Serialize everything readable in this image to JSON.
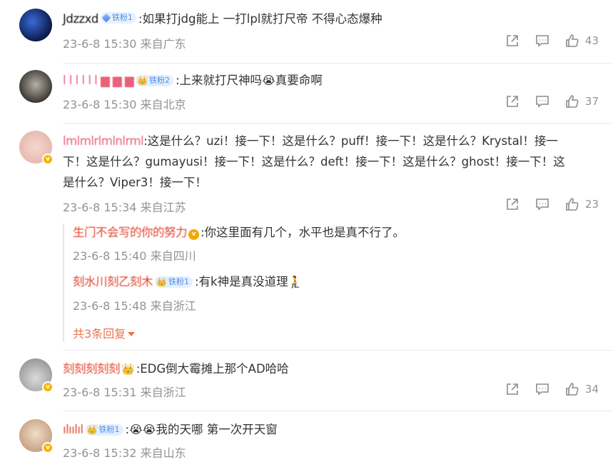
{
  "comments": [
    {
      "username": "Jdzzxd",
      "fan_badge": "铁粉1",
      "text": ":如果打jdg能上 一打lpl就打尺帝 不得心态爆种",
      "time": "23-6-8 15:30",
      "location": "来自广东",
      "likes": "43"
    },
    {
      "username": "l l l l l l    ▆ ▆ ▆",
      "fan_badge": "铁粉2",
      "text": ":上来就打尺神吗",
      "emoji": "😭",
      "text_after": "真要命啊",
      "time": "23-6-8 15:30",
      "location": "来自北京",
      "likes": "37"
    },
    {
      "username": "lmlmlrlmlnlrml",
      "text_line1": ":这是什么？uzi！接一下！这是什么？puff！接一下！这是什么？Krystal！接一",
      "text_line2": "下！这是什么？gumayusi！接一下！这是什么？deft！接一下！这是什么？ghost！接一下！这",
      "text_line3": "是什么？Viper3！接一下！",
      "time": "23-6-8 15:34",
      "location": "来自江苏",
      "likes": "23",
      "replies": [
        {
          "username": "生门不会写的你的努力",
          "text": ":你这里面有几个，水平也是真不行了。",
          "time": "23-6-8 15:40",
          "location": "来自四川"
        },
        {
          "username": "刻水川刻乙刻木",
          "fan_badge": "铁粉1",
          "text": ":有k神是真没道理",
          "emoji": "🧎",
          "time": "23-6-8 15:48",
          "location": "来自浙江"
        }
      ],
      "more_replies": "共3条回复"
    },
    {
      "username": "刻刻刻刻刻",
      "text": ":EDG倒大霉摊上那个AD哈哈",
      "time": "23-6-8 15:31",
      "location": "来自浙江",
      "likes": "34"
    },
    {
      "username": "ılıılıl",
      "fan_badge": "铁粉1",
      "emoji": "😭😭",
      "text": "我的天哪 第一次开天窗",
      "time": "23-6-8 15:32",
      "location": "来自山东"
    }
  ],
  "icons": {
    "share": "share-icon",
    "comment": "comment-icon",
    "like": "thumbs-up-icon"
  },
  "colors": {
    "meta": "#939393",
    "fan_badge_bg": "#e8f1fd",
    "fan_badge_text": "#4f8de6",
    "more_replies": "#eb7350"
  }
}
